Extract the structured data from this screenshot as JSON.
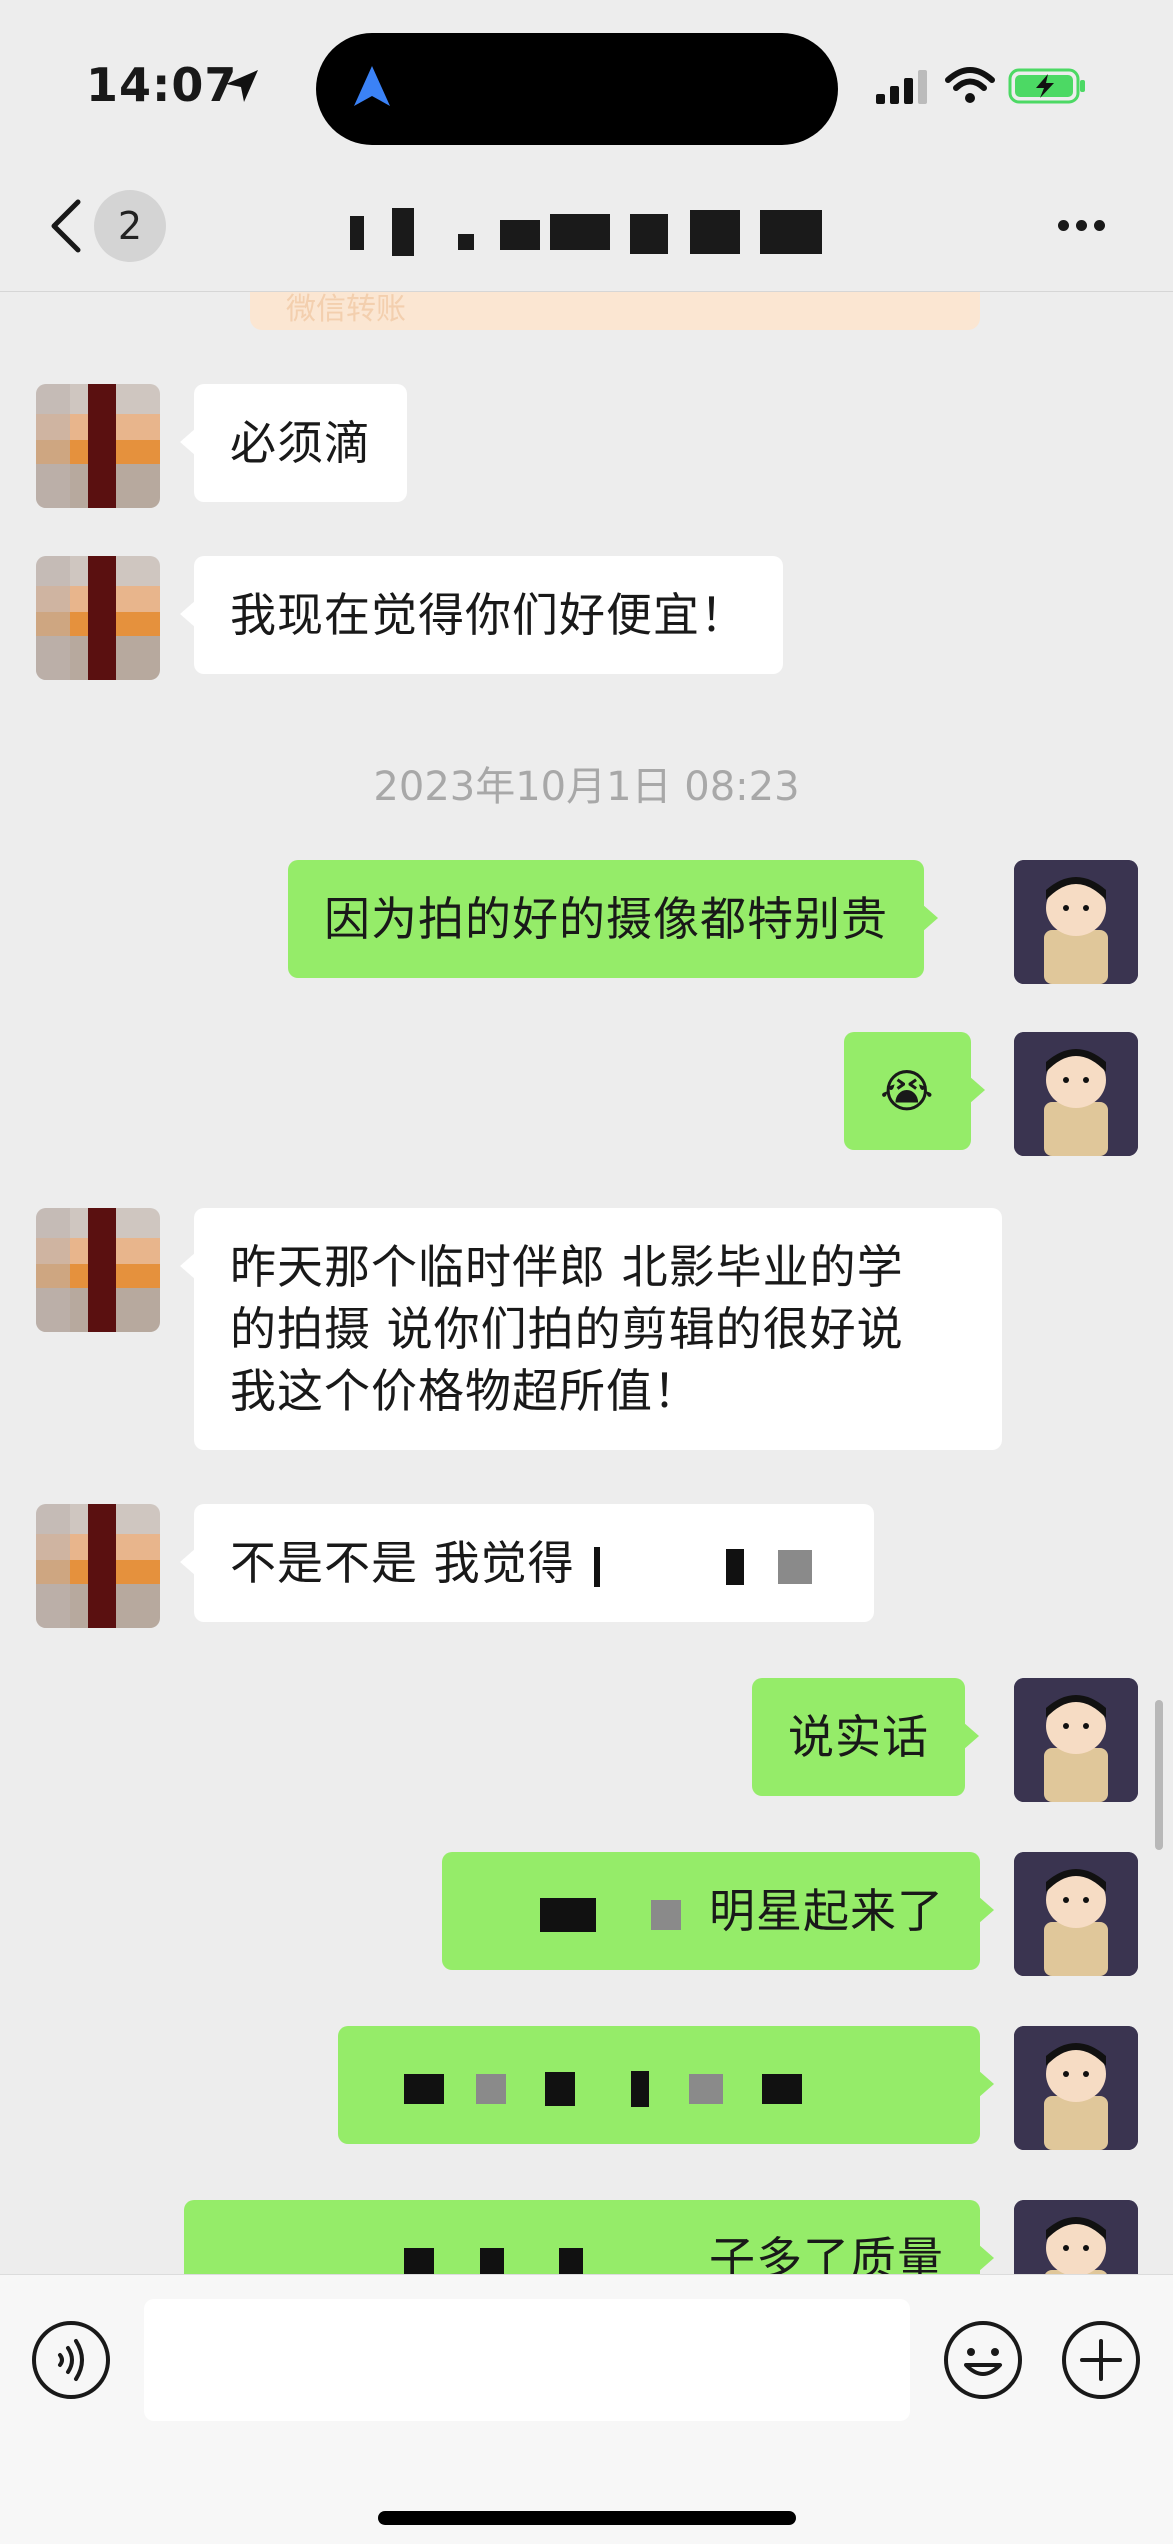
{
  "status_bar": {
    "time": "14:07"
  },
  "nav": {
    "unread_count": "2"
  },
  "transfer_card": {
    "label": "微信转账"
  },
  "timestamp": "2023年10月1日 08:23",
  "messages": [
    {
      "side": "in",
      "text": "必须滴"
    },
    {
      "side": "in",
      "text": "我现在觉得你们好便宜！"
    },
    {
      "side": "out",
      "text": "因为拍的好的摄像都特别贵"
    },
    {
      "side": "out",
      "text": "😭"
    },
    {
      "side": "in",
      "lines": [
        "昨天那个临时伴郎 北影毕业的学",
        "的拍摄 说你们拍的剪辑的很好说",
        "我这个价格物超所值！"
      ]
    },
    {
      "side": "in",
      "text": "不是不是 我觉得"
    },
    {
      "side": "out",
      "text": "说实话"
    },
    {
      "side": "out",
      "text": "明星起来了"
    },
    {
      "side": "out",
      "text": ""
    },
    {
      "side": "out",
      "text": "子多了质量"
    }
  ],
  "input": {
    "placeholder": ""
  },
  "colors": {
    "background": "#ededed",
    "bubble_out": "#95ec69",
    "bubble_in": "#ffffff"
  },
  "icons": [
    "location-arrow-icon",
    "signal-icon",
    "wifi-icon",
    "battery-charging-icon",
    "back-chevron-icon",
    "more-icon",
    "voice-icon",
    "emoji-icon",
    "plus-icon"
  ]
}
